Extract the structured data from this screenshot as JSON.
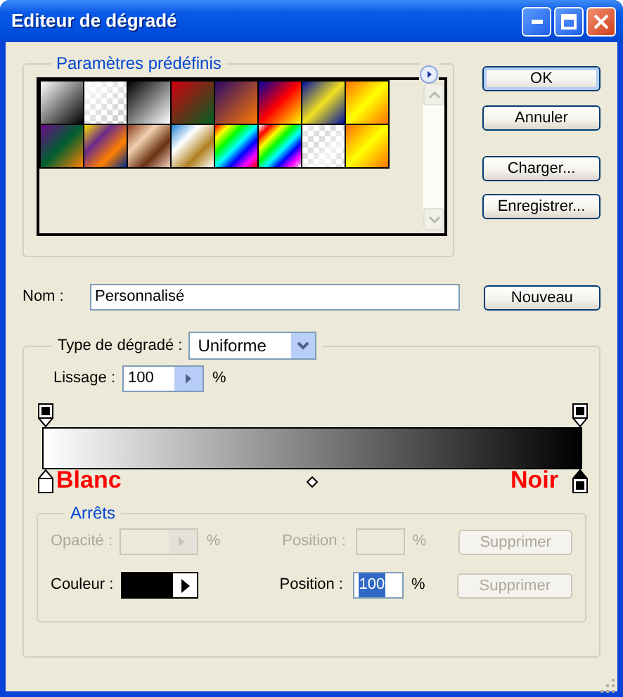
{
  "window": {
    "title": "Editeur de dégradé"
  },
  "presets": {
    "legend": "Paramètres prédéfinis"
  },
  "buttons": [
    {
      "label": "OK",
      "default": true
    },
    {
      "label": "Annuler",
      "default": false
    },
    {
      "label": "Charger...",
      "default": false
    },
    {
      "label": "Enregistrer...",
      "default": false
    }
  ],
  "name": {
    "label": "Nom :",
    "value": "Personnalisé",
    "button": "Nouveau"
  },
  "gradient_type": {
    "label": "Type de dégradé :",
    "value": "Uniforme"
  },
  "smoothness": {
    "label": "Lissage :",
    "value": "100",
    "unit": "%"
  },
  "gradient": {
    "opacity_stops": [
      {
        "level": 0,
        "selected": false
      },
      {
        "level": 1,
        "selected": false
      }
    ],
    "color_stops": [
      {
        "level": 0,
        "color": "#ffffff",
        "selected": false
      },
      {
        "level": 1,
        "color": "#000000",
        "selected": true
      }
    ],
    "midpoints": [
      {
        "level": 0.5
      }
    ],
    "annotations": [
      {
        "text": "Blanc"
      },
      {
        "text": "Noir"
      }
    ]
  },
  "stops": {
    "legend": "Arrêts",
    "rows": [
      {
        "kind": "opacity",
        "disabled": true,
        "label": "Opacité :",
        "unit": "%",
        "position_label": "Position :",
        "position_unit": "%",
        "delete": "Supprimer",
        "delete_disabled": true
      },
      {
        "kind": "color",
        "disabled": false,
        "label": "Couleur :",
        "color": "#000000",
        "position_label": "Position :",
        "position_value": "100",
        "position_text_highlighted": true,
        "position_unit": "%",
        "delete": "Supprimer",
        "delete_disabled": true
      }
    ]
  }
}
